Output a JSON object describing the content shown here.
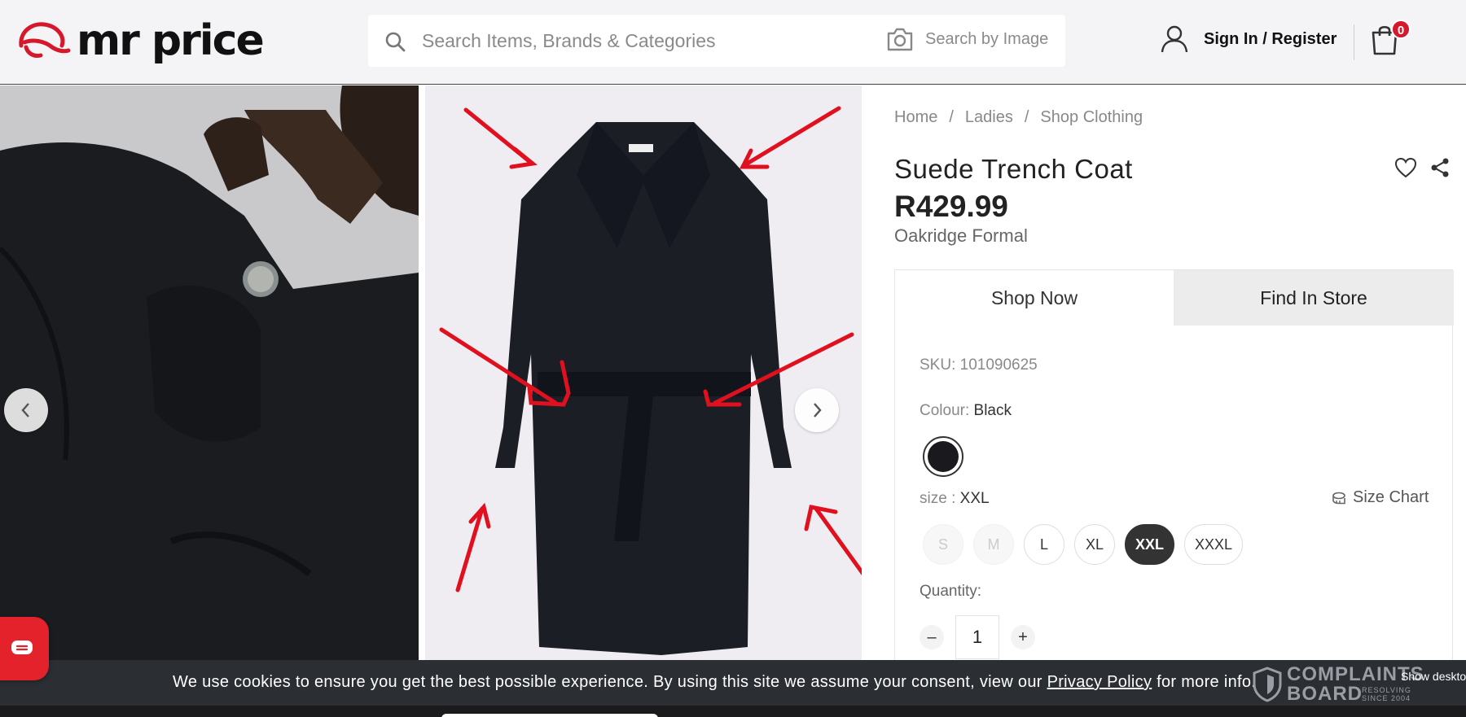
{
  "brand": {
    "logo_text": "mr price",
    "accent": "#d6182b"
  },
  "search": {
    "placeholder": "Search Items, Brands & Categories",
    "image_search_label": "Search by Image"
  },
  "account": {
    "label": "Sign In / Register"
  },
  "cart": {
    "count": "0"
  },
  "breadcrumb": [
    "Home",
    "Ladies",
    "Shop Clothing"
  ],
  "breadcrumb_separator": "/",
  "product": {
    "title": "Suede Trench Coat",
    "price": "R429.99",
    "brand": "Oakridge Formal",
    "sku_label": "SKU:",
    "sku": "101090625",
    "colour_label": "Colour:",
    "colour": "Black",
    "swatch_color": "#1a1a1e",
    "size_label": "size :",
    "size": "XXL",
    "size_chart_label": "Size Chart",
    "sizes": [
      {
        "label": "S",
        "state": "disabled"
      },
      {
        "label": "M",
        "state": "disabled"
      },
      {
        "label": "L",
        "state": "available"
      },
      {
        "label": "XL",
        "state": "available"
      },
      {
        "label": "XXL",
        "state": "selected"
      },
      {
        "label": "XXXL",
        "state": "available"
      }
    ],
    "quantity_label": "Quantity:",
    "quantity": "1",
    "minus_symbol": "–",
    "plus_symbol": "+"
  },
  "tabs": {
    "shop_now": "Shop Now",
    "find_in_store": "Find In Store"
  },
  "cookie": {
    "text_before": "We use cookies to ensure you get the best possible experience. By using this site we assume your consent, view our ",
    "link": "Privacy Policy",
    "text_after": " for more info."
  },
  "watermark": {
    "line1": "COMPLAINTS",
    "line2": "BOARD",
    "tagline": "RESOLVING SINCE 2004"
  },
  "show_desktop": "Show deskto"
}
